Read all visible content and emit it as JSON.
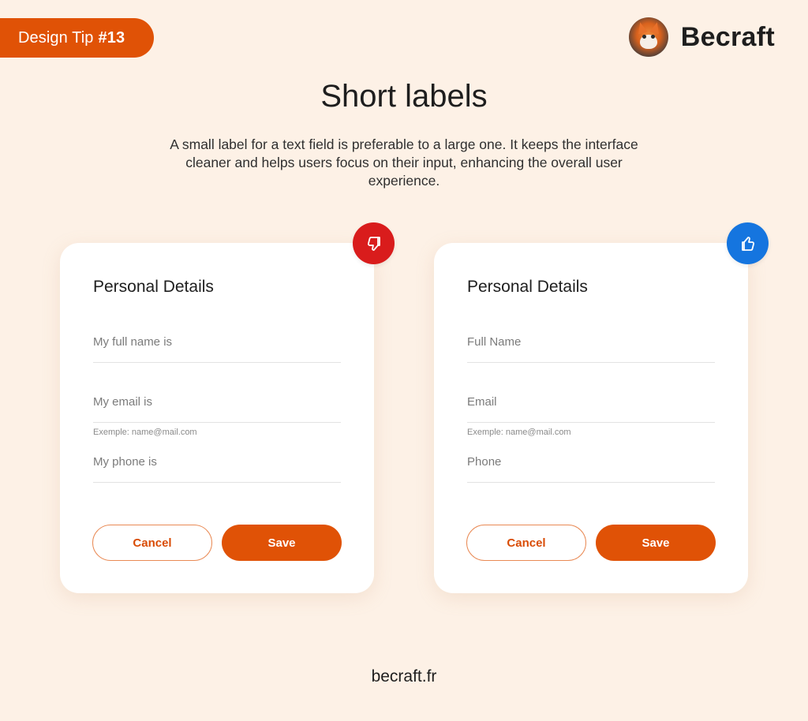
{
  "badge": {
    "label": "Design Tip",
    "number": "#13"
  },
  "brand": {
    "name": "Becraft",
    "avatar_icon": "fox-avatar"
  },
  "header": {
    "title": "Short labels",
    "description": "A small label for a text field is preferable to a large one. It keeps the interface cleaner and helps users focus on their input, enhancing the overall user experience."
  },
  "colors": {
    "background": "#fdf1e6",
    "accent": "#e05206",
    "bad": "#d91c1c",
    "good": "#1575df"
  },
  "cards": [
    {
      "verdict": "bad",
      "verdict_icon": "thumbs-down-icon",
      "title": "Personal Details",
      "fields": [
        {
          "placeholder": "My full name is",
          "value": ""
        },
        {
          "placeholder": "My email is",
          "value": "",
          "helper": "Exemple: name@mail.com"
        },
        {
          "placeholder": "My phone is",
          "value": ""
        }
      ],
      "buttons": {
        "cancel": "Cancel",
        "save": "Save"
      }
    },
    {
      "verdict": "good",
      "verdict_icon": "thumbs-up-icon",
      "title": "Personal Details",
      "fields": [
        {
          "placeholder": "Full Name",
          "value": ""
        },
        {
          "placeholder": "Email",
          "value": "",
          "helper": "Exemple: name@mail.com"
        },
        {
          "placeholder": "Phone",
          "value": ""
        }
      ],
      "buttons": {
        "cancel": "Cancel",
        "save": "Save"
      }
    }
  ],
  "footer": {
    "url": "becraft.fr"
  }
}
